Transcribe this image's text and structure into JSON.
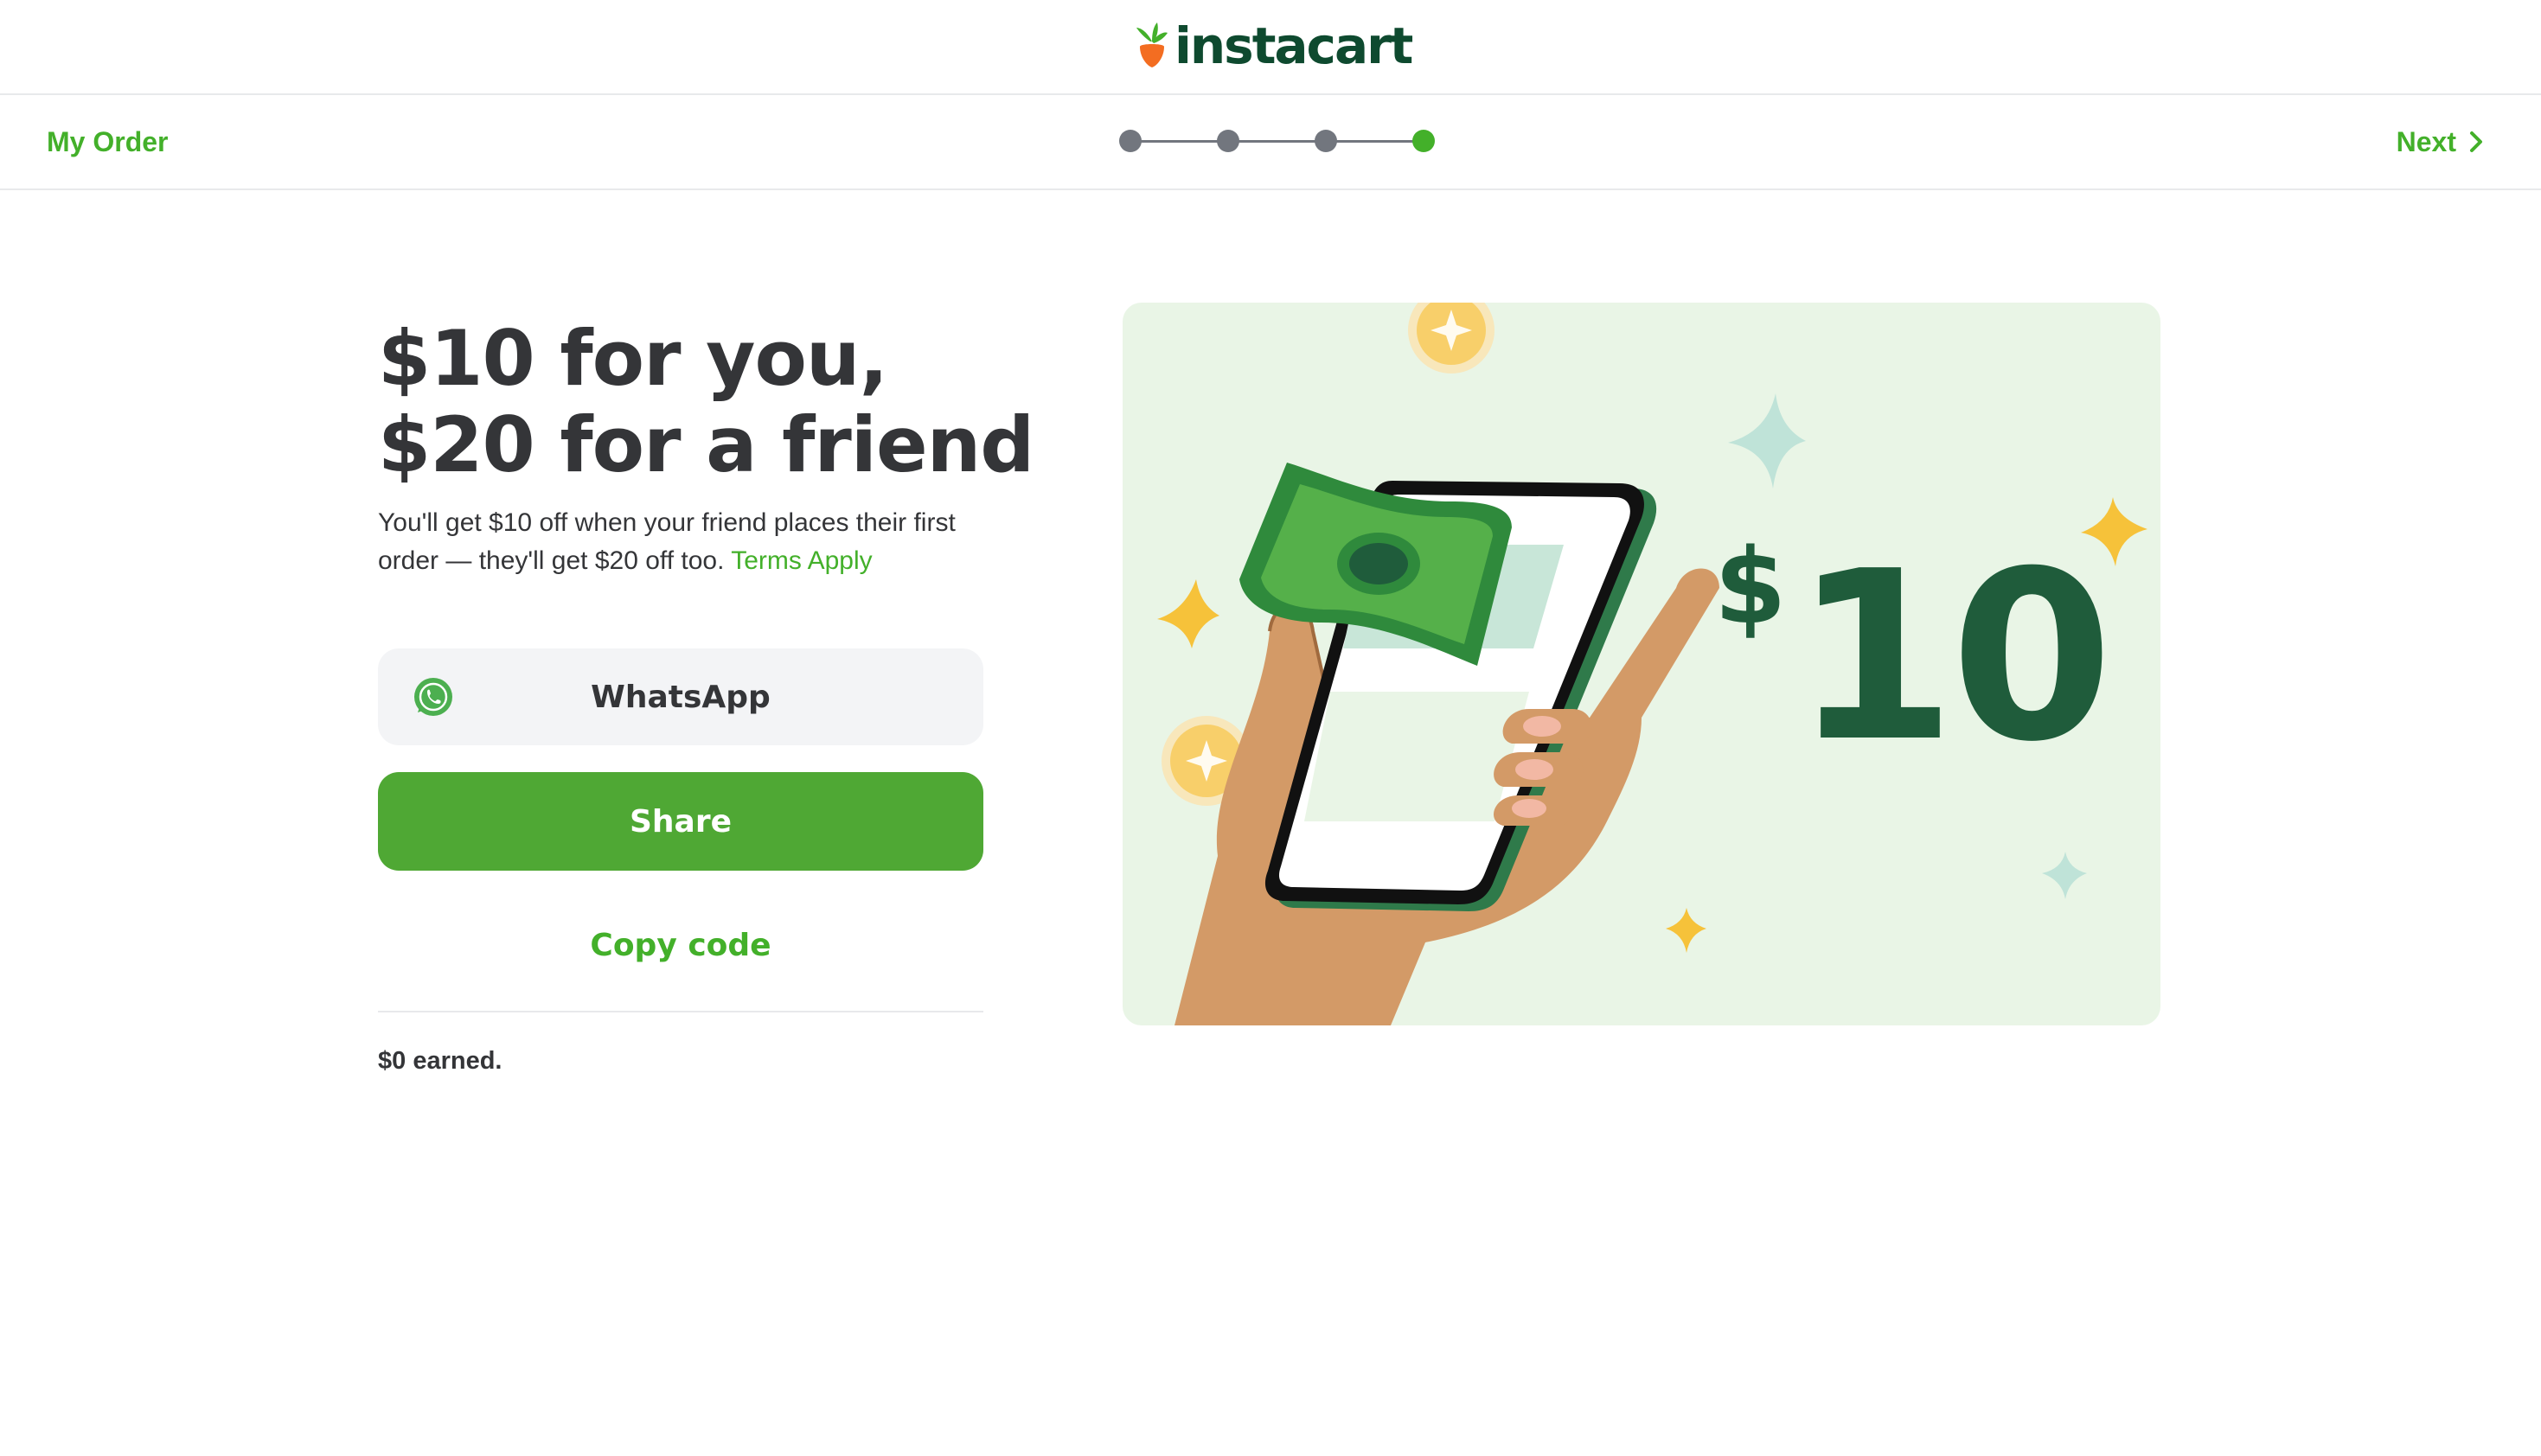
{
  "header": {
    "logo_text": "instacart",
    "brand_color": "#0e4a2f",
    "carrot_color": "#f36d21",
    "leaf_color": "#43b02a"
  },
  "nav": {
    "back_label": "My Order",
    "next_label": "Next",
    "steps_total": 4,
    "current_step": 4
  },
  "content": {
    "headline_line1": "$10 for you,",
    "headline_line2": "$20 for a friend",
    "description": "You'll get $10 off when your friend places their first order — they'll get $20 off too.",
    "terms_link": "Terms Apply",
    "whatsapp_label": "WhatsApp",
    "share_label": "Share",
    "copy_code_label": "Copy code",
    "earned_text": "$0 earned."
  },
  "illustration": {
    "currency_symbol": "$",
    "amount": "10",
    "icons": [
      "hand-icon",
      "phone-icon",
      "dollar-bill-icon",
      "coin-icon",
      "sparkle-icon"
    ]
  },
  "colors": {
    "accent_green": "#43b02a",
    "button_green": "#4fa834",
    "dark_green": "#1f5c3b",
    "illustration_bg": "#e9f5e6",
    "text": "#343538"
  }
}
